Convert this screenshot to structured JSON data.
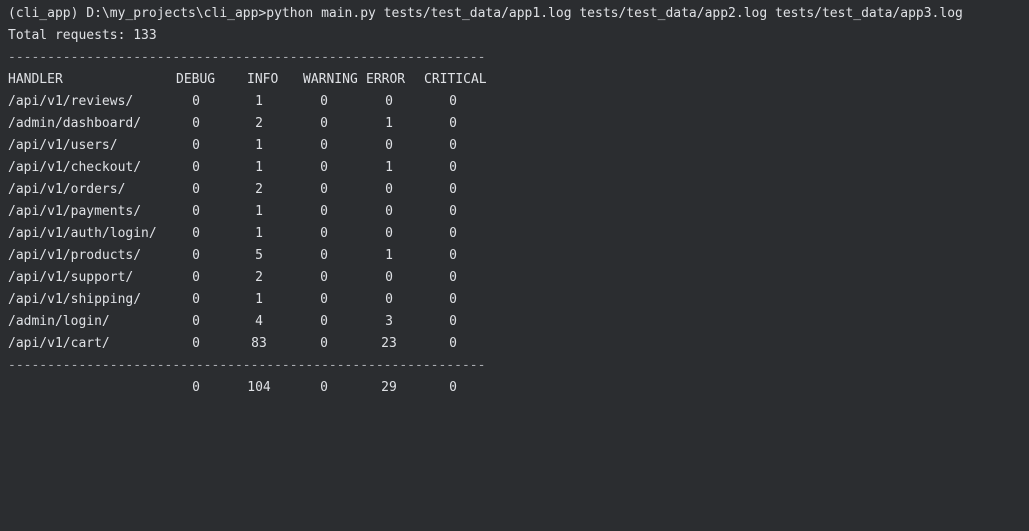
{
  "terminal": {
    "command_line": "(cli_app) D:\\my_projects\\cli_app>python main.py tests/test_data/app1.log tests/test_data/app2.log tests/test_data/app3.log",
    "total_line": "Total requests: 133",
    "separator": "-----------------------------------------------------------------------------"
  },
  "report": {
    "headers": {
      "handler": "HANDLER",
      "debug": "DEBUG",
      "info": "INFO",
      "warning": "WARNING",
      "error": "ERROR",
      "critical": "CRITICAL"
    },
    "rows": [
      {
        "handler": "/api/v1/reviews/",
        "debug": "0",
        "info": "1",
        "warning": "0",
        "error": "0",
        "critical": "0"
      },
      {
        "handler": "/admin/dashboard/",
        "debug": "0",
        "info": "2",
        "warning": "0",
        "error": "1",
        "critical": "0"
      },
      {
        "handler": "/api/v1/users/",
        "debug": "0",
        "info": "1",
        "warning": "0",
        "error": "0",
        "critical": "0"
      },
      {
        "handler": "/api/v1/checkout/",
        "debug": "0",
        "info": "1",
        "warning": "0",
        "error": "1",
        "critical": "0"
      },
      {
        "handler": "/api/v1/orders/",
        "debug": "0",
        "info": "2",
        "warning": "0",
        "error": "0",
        "critical": "0"
      },
      {
        "handler": "/api/v1/payments/",
        "debug": "0",
        "info": "1",
        "warning": "0",
        "error": "0",
        "critical": "0"
      },
      {
        "handler": "/api/v1/auth/login/",
        "debug": "0",
        "info": "1",
        "warning": "0",
        "error": "0",
        "critical": "0"
      },
      {
        "handler": "/api/v1/products/",
        "debug": "0",
        "info": "5",
        "warning": "0",
        "error": "1",
        "critical": "0"
      },
      {
        "handler": "/api/v1/support/",
        "debug": "0",
        "info": "2",
        "warning": "0",
        "error": "0",
        "critical": "0"
      },
      {
        "handler": "/api/v1/shipping/",
        "debug": "0",
        "info": "1",
        "warning": "0",
        "error": "0",
        "critical": "0"
      },
      {
        "handler": "/admin/login/",
        "debug": "0",
        "info": "4",
        "warning": "0",
        "error": "3",
        "critical": "0"
      },
      {
        "handler": "/api/v1/cart/",
        "debug": "0",
        "info": "83",
        "warning": "0",
        "error": "23",
        "critical": "0"
      }
    ],
    "totals": {
      "debug": "0",
      "info": "104",
      "warning": "0",
      "error": "29",
      "critical": "0"
    }
  },
  "colors": {
    "background": "#2b2d30",
    "text": "#dfe1e5"
  }
}
